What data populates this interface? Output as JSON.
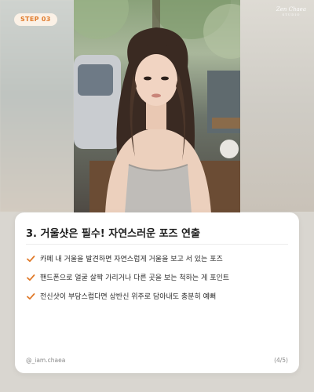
{
  "step_badge": "STEP 03",
  "watermark": {
    "line1": "Zen Chaea",
    "line2": "STUDIO"
  },
  "card": {
    "title": "3. 거울샷은 필수! 자연스러운 포즈 연출",
    "bullets": [
      {
        "icon": "checkmark-icon",
        "text": "카페 내 거울을 발견하면 자연스럽게 거울을 보고 서 있는 포즈"
      },
      {
        "icon": "checkmark-icon",
        "text": "핸드폰으로 얼굴 살짝 가리거나 다른 곳을 보는 척하는 게 포인트"
      },
      {
        "icon": "checkmark-icon",
        "text": "전신샷이 부담스럽다면 상반신 위주로 담아내도 충분히 예뻐"
      }
    ],
    "handle": "@_iam.chaea",
    "page_indicator": "(4/5)"
  },
  "colors": {
    "accent": "#e07a2a",
    "badge_bg": "#fbf1e6",
    "text": "#1d1d1d",
    "muted": "#8a8a8a"
  }
}
